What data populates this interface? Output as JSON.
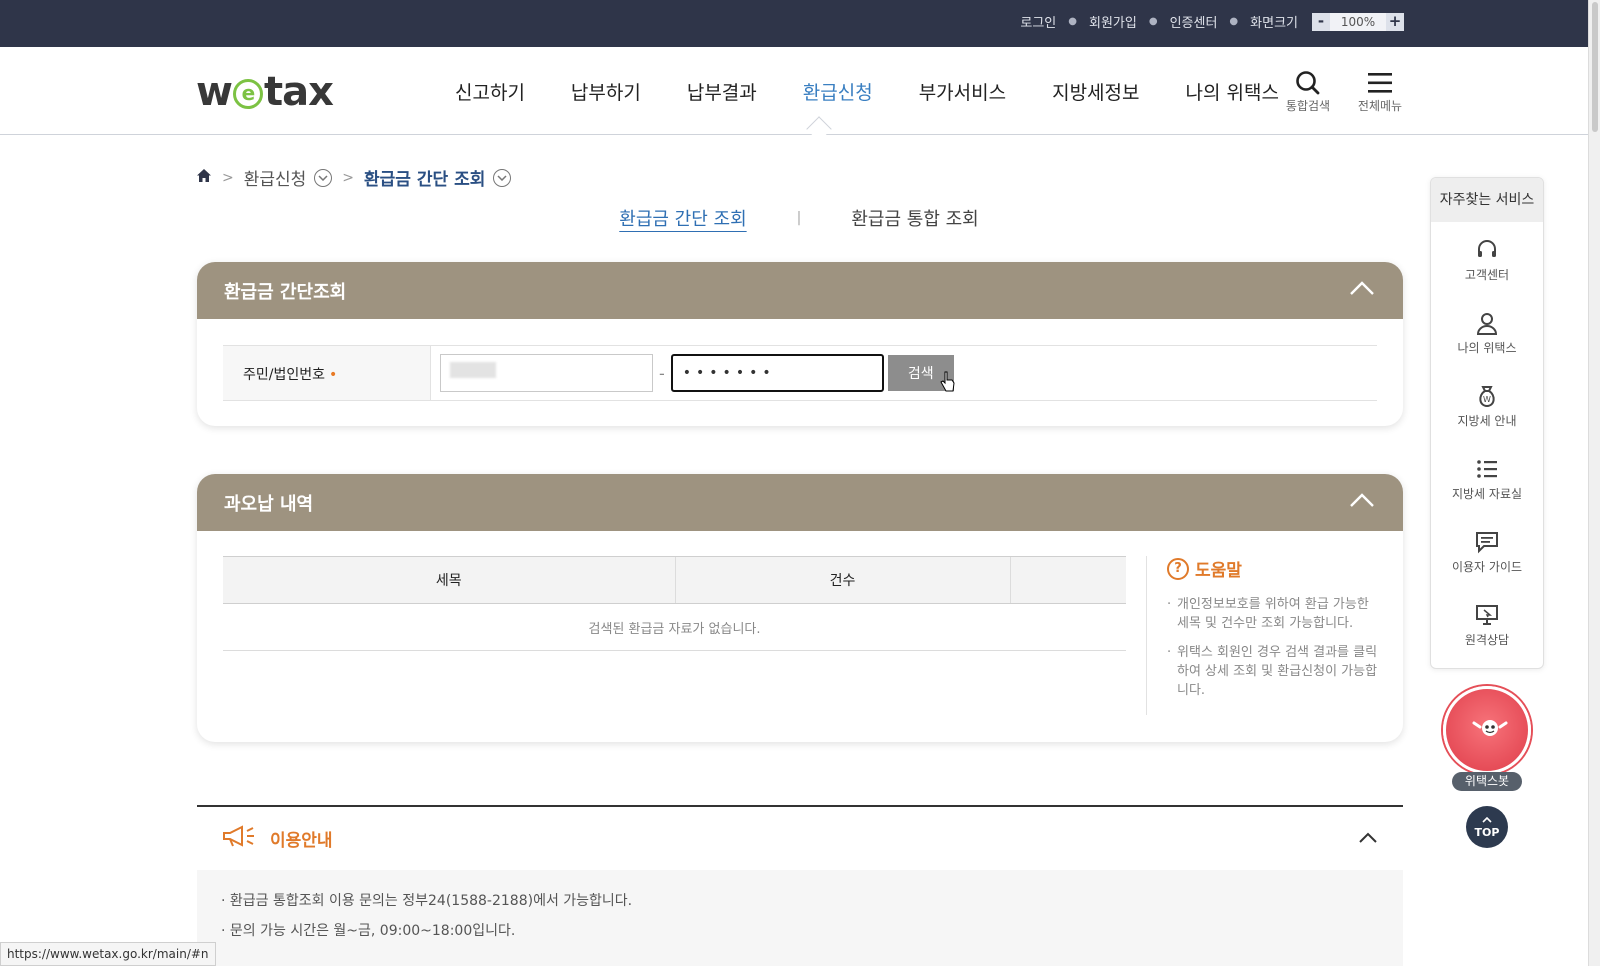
{
  "topbar": {
    "login": "로그인",
    "signup": "회원가입",
    "cert_center": "인증센터",
    "screen_size_label": "화면크기",
    "zoom_minus": "-",
    "zoom_value": "100%",
    "zoom_plus": "+"
  },
  "header": {
    "logo_left": "w",
    "logo_e": "e",
    "logo_right": "tax",
    "nav": [
      "신고하기",
      "납부하기",
      "납부결과",
      "환급신청",
      "부가서비스",
      "지방세정보",
      "나의 위택스"
    ],
    "search_label": "통합검색",
    "menu_label": "전체메뉴"
  },
  "breadcrumb": {
    "level1": "환급신청",
    "level2": "환급금 간단 조회"
  },
  "subtabs": {
    "tab1": "환급금 간단 조회",
    "tab2": "환급금 통합 조회"
  },
  "panel1": {
    "title": "환급금 간단조회",
    "field_label": "주민/법인번호",
    "required_mark": "•",
    "second_value": "•••••••",
    "search_button": "검색"
  },
  "panel2": {
    "title": "과오납 내역",
    "columns": [
      "세목",
      "건수",
      ""
    ],
    "empty_message": "검색된 환급금 자료가 없습니다.",
    "help_title": "도움말",
    "help_items": [
      "개인정보보호를 위하여 환급 가능한 세목 및 건수만 조회 가능합니다.",
      "위택스 회원인 경우 검색 결과를 클릭하여 상세 조회 및 환급신청이 가능합니다."
    ]
  },
  "guide": {
    "title": "이용안내",
    "items": [
      "· 환급금 통합조회 이용 문의는 정부24(1588-2188)에서 가능합니다.",
      "· 문의 가능 시간은 월~금, 09:00~18:00입니다."
    ]
  },
  "quick": {
    "title": "자주찾는 서비스",
    "items": [
      "고객센터",
      "나의 위택스",
      "지방세 안내",
      "지방세 자료실",
      "이용자 가이드",
      "원격상담"
    ]
  },
  "bot_label": "위택스봇",
  "top_button": "TOP",
  "status_url": "https://www.wetax.go.kr/main/#n",
  "colors": {
    "topbar": "#2f3549",
    "panel_header": "#9e9380",
    "active_nav": "#3a7fc1",
    "accent_orange": "#e07a2a"
  }
}
